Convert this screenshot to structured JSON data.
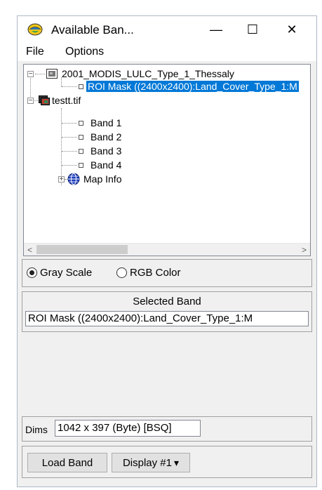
{
  "window": {
    "title": "Available Ban...",
    "minimize_glyph": "—",
    "maximize_glyph": "☐",
    "close_glyph": "✕"
  },
  "menu": {
    "items": [
      "File",
      "Options"
    ]
  },
  "tree": {
    "file1": {
      "name": "2001_MODIS_LULC_Type_1_Thessaly",
      "expander": "−",
      "bands": [
        "ROI Mask ((2400x2400):Land_Cover_Type_1:M"
      ]
    },
    "file2": {
      "name": "testt.tif",
      "expander": "−",
      "bands": [
        "Band 1",
        "Band 2",
        "Band 3",
        "Band 4"
      ],
      "map_info": {
        "label": "Map Info",
        "expander": "+"
      }
    }
  },
  "scrollbar": {
    "left_arrow": "<",
    "right_arrow": ">"
  },
  "color_mode": {
    "gray_label": "Gray Scale",
    "rgb_label": "RGB Color",
    "selected": "gray"
  },
  "selected_band": {
    "title": "Selected Band",
    "value": "ROI Mask ((2400x2400):Land_Cover_Type_1:M"
  },
  "dims": {
    "label": "Dims",
    "value": "1042 x 397 (Byte) [BSQ]"
  },
  "buttons": {
    "load_band": "Load Band",
    "display": "Display #1",
    "display_arrow": "▾"
  },
  "colors": {
    "selection": "#0078d7",
    "panel_bg": "#f0f0f0"
  }
}
